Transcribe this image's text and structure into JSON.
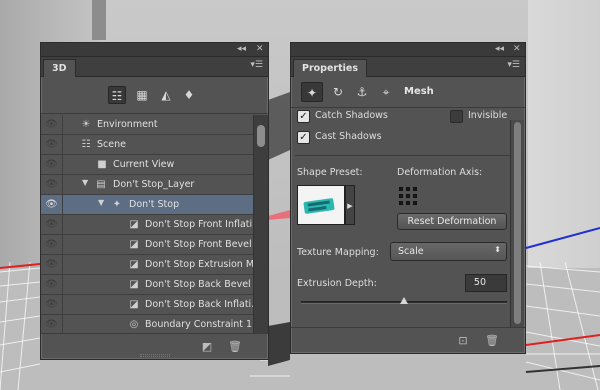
{
  "panel_3d": {
    "tab_label": "3D",
    "filters": [
      {
        "name": "whole-scene",
        "icon": "scene-filter-icon",
        "active": true
      },
      {
        "name": "meshes",
        "icon": "mesh-filter-icon"
      },
      {
        "name": "materials",
        "icon": "material-filter-icon"
      },
      {
        "name": "lights",
        "icon": "light-filter-icon"
      }
    ],
    "rows": [
      {
        "label": "Environment",
        "icon": "environment-icon",
        "indent": 0,
        "visible": false
      },
      {
        "label": "Scene",
        "icon": "scene-icon",
        "indent": 0,
        "visible": false
      },
      {
        "label": "Current View",
        "icon": "camera-icon",
        "indent": 1,
        "visible": false
      },
      {
        "label": "Don't Stop_Layer",
        "icon": "folder-icon",
        "indent": 1,
        "visible": false,
        "expanded": true
      },
      {
        "label": "Don't Stop",
        "icon": "mesh-icon",
        "indent": 2,
        "visible": true,
        "expanded": true,
        "selected": true
      },
      {
        "label": "Don't Stop Front Inflati...",
        "icon": "material-icon",
        "indent": 3,
        "visible": false
      },
      {
        "label": "Don't Stop Front Bevel ...",
        "icon": "material-icon",
        "indent": 3,
        "visible": false
      },
      {
        "label": "Don't Stop Extrusion M...",
        "icon": "material-icon",
        "indent": 3,
        "visible": false
      },
      {
        "label": "Don't Stop Back Bevel ...",
        "icon": "material-icon",
        "indent": 3,
        "visible": false
      },
      {
        "label": "Don't Stop Back Inflati...",
        "icon": "material-icon",
        "indent": 3,
        "visible": false
      },
      {
        "label": "Boundary Constraint 1",
        "icon": "constraint-icon",
        "indent": 3,
        "visible": false
      }
    ]
  },
  "panel_properties": {
    "tab_label": "Properties",
    "type_label": "Mesh",
    "catch_shadows": {
      "label": "Catch Shadows",
      "checked": true
    },
    "invisible": {
      "label": "Invisible",
      "checked": false
    },
    "cast_shadows": {
      "label": "Cast Shadows",
      "checked": true
    },
    "shape_preset_label": "Shape Preset:",
    "deformation_axis_label": "Deformation Axis:",
    "reset_deformation_label": "Reset Deformation",
    "texture_mapping_label": "Texture Mapping:",
    "texture_mapping_value": "Scale",
    "extrusion_depth_label": "Extrusion Depth:",
    "extrusion_depth_value": "50",
    "extrusion_depth_slider_fraction": 0.5
  },
  "colors": {
    "panel_bg": "#535353",
    "selected_row": "#5d6d84",
    "axis_red": "#e02020",
    "axis_blue": "#2030d0"
  }
}
